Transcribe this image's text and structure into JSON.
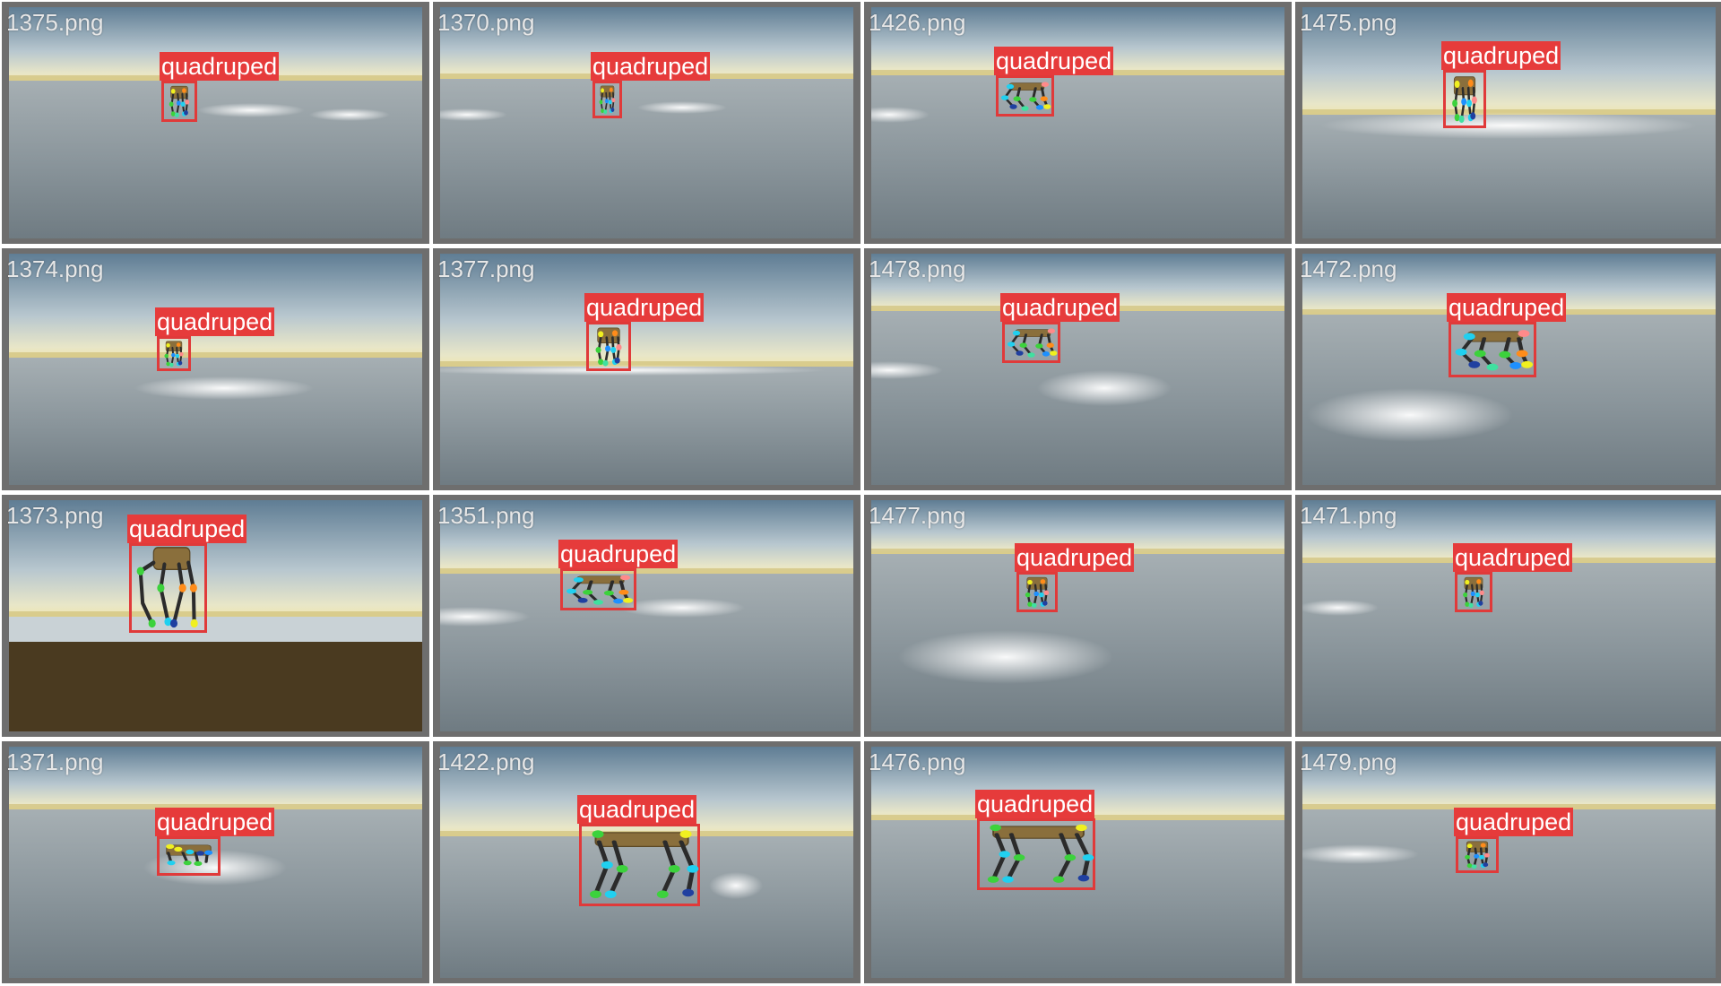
{
  "detection_label": "quadruped",
  "colors": {
    "box": "#e03a3a",
    "label_bg": "#e63b3b",
    "cell_border": "#6e6e6e",
    "robot_body": "#8a6f3c",
    "robot_leg": "#2b2b2b",
    "floor_dark": "#4a3a20",
    "keypoints": [
      "#f0f020",
      "#3cd23c",
      "#20d0f0",
      "#1e90ff",
      "#ff8c1a",
      "#ff8a8a",
      "#2040a0",
      "#40e0a0"
    ]
  },
  "images": [
    {
      "file": "1375.png",
      "label": "quadruped"
    },
    {
      "file": "1370.png",
      "label": "quadruped"
    },
    {
      "file": "1426.png",
      "label": "quadruped"
    },
    {
      "file": "1475.png",
      "label": "quadruped"
    },
    {
      "file": "1374.png",
      "label": "quadruped"
    },
    {
      "file": "1377.png",
      "label": "quadruped"
    },
    {
      "file": "1478.png",
      "label": "quadruped"
    },
    {
      "file": "1472.png",
      "label": "quadruped"
    },
    {
      "file": "1373.png",
      "label": "quadruped"
    },
    {
      "file": "1351.png",
      "label": "quadruped"
    },
    {
      "file": "1477.png",
      "label": "quadruped"
    },
    {
      "file": "1471.png",
      "label": "quadruped"
    },
    {
      "file": "1371.png",
      "label": "quadruped"
    },
    {
      "file": "1422.png",
      "label": "quadruped"
    },
    {
      "file": "1476.png",
      "label": "quadruped"
    },
    {
      "file": "1479.png",
      "label": "quadruped"
    }
  ]
}
